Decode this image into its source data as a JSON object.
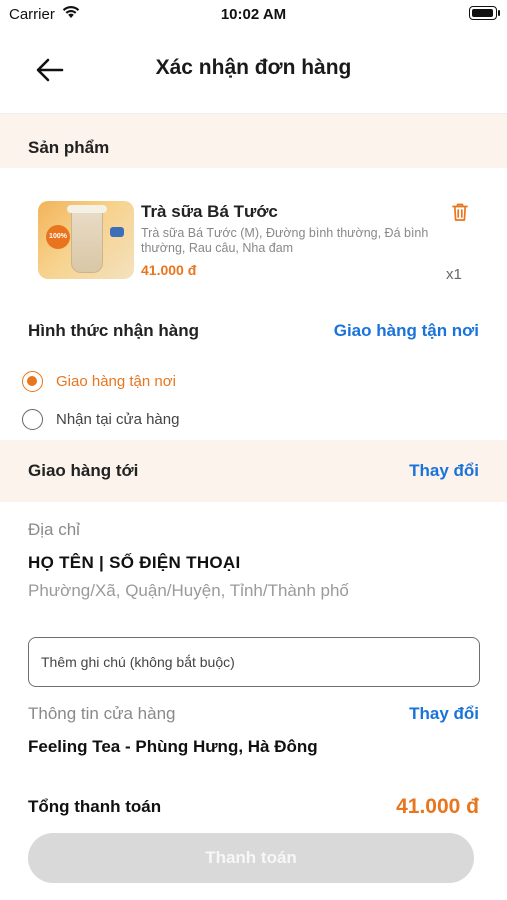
{
  "status_bar": {
    "carrier": "Carrier",
    "time": "10:02 AM"
  },
  "header": {
    "title": "Xác nhận đơn hàng",
    "back_icon": "arrow-left-icon"
  },
  "products_section": {
    "title": "Sản phẩm"
  },
  "product": {
    "name": "Trà sữa Bá Tước",
    "options": "Trà sữa Bá Tước (M), Đường bình thường, Đá bình thường, Rau câu, Nha đam",
    "price": "41.000 đ",
    "quantity": "x1",
    "delete_icon": "trash-icon"
  },
  "delivery_method": {
    "title": "Hình thức nhận hàng",
    "selected_value": "Giao hàng tận nơi",
    "options": [
      {
        "label": "Giao hàng tận nơi",
        "selected": true
      },
      {
        "label": "Nhận tại cửa hàng",
        "selected": false
      }
    ]
  },
  "delivery_to": {
    "title": "Giao hàng tới",
    "action": "Thay đổi"
  },
  "address": {
    "label": "Địa chỉ",
    "name_phone": "HỌ TÊN | SỐ ĐIỆN THOẠI",
    "detail": "Phường/Xã, Quận/Huyện, Tỉnh/Thành phố"
  },
  "note": {
    "placeholder": "Thêm ghi chú (không bắt buộc)",
    "value": ""
  },
  "store": {
    "label": "Thông tin cửa hàng",
    "action": "Thay đổi",
    "name": "Feeling Tea - Phùng Hưng, Hà Đông"
  },
  "summary": {
    "total_label": "Tổng thanh toán",
    "total_value": "41.000 đ"
  },
  "pay_button": {
    "label": "Thanh toán",
    "enabled": false
  },
  "colors": {
    "accent": "#e8761e",
    "link": "#1a73d9",
    "section_bg": "#fbf3ec",
    "disabled_button": "#d9d9d9"
  }
}
